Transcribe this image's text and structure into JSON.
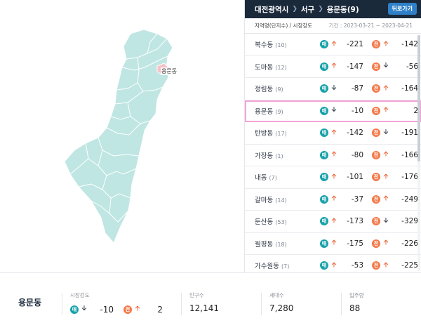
{
  "header": {
    "city": "대전광역시",
    "district": "서구",
    "dong": "용문동(9)",
    "back_label": "뒤로가기"
  },
  "subheader": {
    "label": "지역명(단지수) / 시장강도",
    "period": "기간 : 2023-03-21 ~ 2023-04-21"
  },
  "map": {
    "selected_label": "용문동",
    "fill_color": "#bfe6e3",
    "selected_color": "#f7c1c8"
  },
  "rows": [
    {
      "name": "복수동",
      "count": "(10)",
      "m_dir": "up",
      "m_val": "-221",
      "j_dir": "up",
      "j_val": "-142"
    },
    {
      "name": "도마동",
      "count": "(12)",
      "m_dir": "up",
      "m_val": "-147",
      "j_dir": "down",
      "j_val": "-56"
    },
    {
      "name": "정림동",
      "count": "(9)",
      "m_dir": "down",
      "m_val": "-87",
      "j_dir": "up",
      "j_val": "-164"
    },
    {
      "name": "용문동",
      "count": "(9)",
      "m_dir": "down",
      "m_val": "-10",
      "j_dir": "up",
      "j_val": "2",
      "selected": true
    },
    {
      "name": "탄방동",
      "count": "(17)",
      "m_dir": "up",
      "m_val": "-142",
      "j_dir": "down",
      "j_val": "-191"
    },
    {
      "name": "가장동",
      "count": "(1)",
      "m_dir": "up",
      "m_val": "-80",
      "j_dir": "up",
      "j_val": "-166"
    },
    {
      "name": "내동",
      "count": "(7)",
      "m_dir": "up",
      "m_val": "-101",
      "j_dir": "up",
      "j_val": "-176"
    },
    {
      "name": "갈마동",
      "count": "(14)",
      "m_dir": "up",
      "m_val": "-37",
      "j_dir": "up",
      "j_val": "-249"
    },
    {
      "name": "둔산동",
      "count": "(53)",
      "m_dir": "up",
      "m_val": "-173",
      "j_dir": "down",
      "j_val": "-329"
    },
    {
      "name": "월평동",
      "count": "(18)",
      "m_dir": "up",
      "m_val": "-175",
      "j_dir": "up",
      "j_val": "-226"
    },
    {
      "name": "가수원동",
      "count": "(7)",
      "m_dir": "up",
      "m_val": "-53",
      "j_dir": "up",
      "j_val": "-225"
    }
  ],
  "badges": {
    "maemae": "매",
    "jeonse": "전"
  },
  "bottom": {
    "name": "용문동",
    "strength_label": "시장강도",
    "strength_m_val": "-10",
    "strength_j_val": "2",
    "pop_label": "인구수",
    "pop_val": "12,141",
    "house_label": "세대수",
    "house_val": "7,280",
    "resident_label": "입주량",
    "resident_val": "88"
  }
}
